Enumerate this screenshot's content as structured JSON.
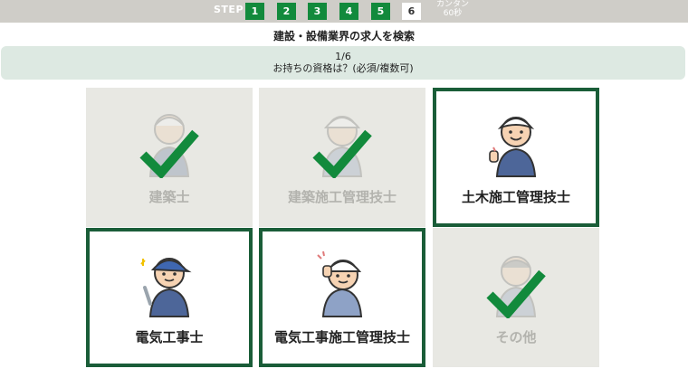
{
  "stepbar": {
    "label": "STEP",
    "steps": [
      "1",
      "2",
      "3",
      "4",
      "5",
      "6"
    ],
    "current_step": "6",
    "note_line1": "カンタン",
    "note_line2": "60秒"
  },
  "title": "建設・設備業界の求人を検索",
  "question": {
    "counter": "1/6",
    "text": "お持ちの資格は？(必須/複数可)"
  },
  "options": [
    {
      "label": "建築士",
      "state": "checked",
      "icon": "worker-thumbsup-icon"
    },
    {
      "label": "建築施工管理技士",
      "state": "checked",
      "icon": "worker-helmet-icon"
    },
    {
      "label": "土木施工管理技士",
      "state": "unchecked",
      "icon": "worker-thumbsup-icon"
    },
    {
      "label": "電気工事士",
      "state": "unchecked",
      "icon": "electrician-wrench-icon"
    },
    {
      "label": "電気工事施工管理技士",
      "state": "unchecked",
      "icon": "worker-helmet-icon"
    },
    {
      "label": "その他",
      "state": "checked",
      "icon": "worker-icon"
    }
  ],
  "colors": {
    "accent_green": "#128a3c",
    "dark_green_border": "#1a5d38",
    "question_bg": "#dde9e2",
    "stepbar_bg": "#cfcdc8"
  }
}
